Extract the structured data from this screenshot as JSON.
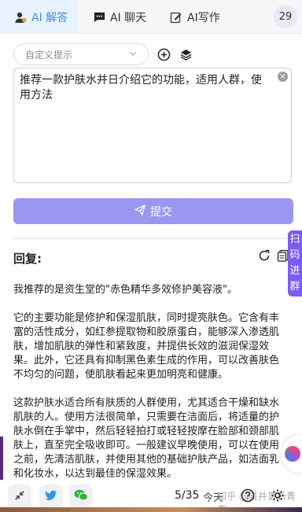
{
  "tabs": [
    {
      "label": "AI 解答",
      "icon": "user-badge-icon",
      "active": true
    },
    {
      "label": "AI 聊天",
      "icon": "chat-bubble-icon",
      "active": false
    },
    {
      "label": "AI写作",
      "icon": "edit-document-icon",
      "active": false
    }
  ],
  "count_badge": "29",
  "prompt_select": {
    "placeholder": "自定义提示",
    "icon": "chevron-down-icon"
  },
  "input": {
    "value": "推荐一款护肤水并日介绍它的功能，适用人群，使用方法"
  },
  "submit_label": "提交",
  "reply": {
    "heading": "回复:",
    "paragraphs": [
      "我推荐的是资生堂的\"赤色精华多效修护美容液\"。",
      "它的主要功能是修护和保湿肌肤，同时提亮肤色。它含有丰富的活性成分，如红参提取物和胶原蛋白，能够深入渗透肌肤，增加肌肤的弹性和紧致度，并提供长效的滋润保湿效果。此外，它还具有抑制黑色素生成的作用，可以改善肤色不均匀的问题，使肌肤看起来更加明亮和健康。",
      "这款护肤水适合所有肤质的人群使用，尤其适合干燥和缺水肌肤的人。使用方法很简单，只需要在洁面后，将适量的护肤水倒在手掌中，然后轻轻拍打或轻轻按摩在脸部和颈部肌肤上，直至完全吸收即可。一般建议早晚使用，可以在使用之前，先清洁肌肤，并使用其他的基础护肤产品，如洁面乳和化妆水，以达到最佳的保湿效果。"
    ]
  },
  "side_tab": "扫码进群",
  "footer": {
    "page_indicator": "5/35",
    "today_label": "今天",
    "watermark": "知乎 @碰井更新青春"
  },
  "colors": {
    "accent": "#3f8fe0",
    "submit_bg": "#9b96f0",
    "side_tab_bg": "#7a5cf0"
  }
}
